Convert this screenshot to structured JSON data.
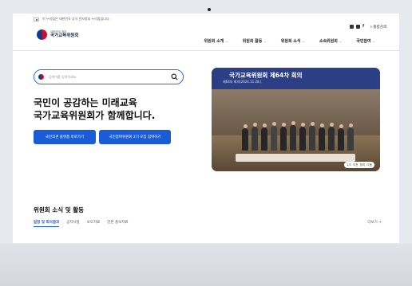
{
  "notice": "이 누리집은 대한민국 공식 전자정부 누리집입니다.",
  "logo": {
    "sub": "대한민국 정부",
    "name": "국가교육위원회"
  },
  "util": {
    "links": [
      "블로그",
      "유튜브",
      "페이스북"
    ],
    "search_label": "통합검색"
  },
  "nav": [
    {
      "label": "위원회 소개"
    },
    {
      "label": "위원회 활동"
    },
    {
      "label": "위원회 소식"
    },
    {
      "label": "소속위원회"
    },
    {
      "label": "국민참여"
    }
  ],
  "search": {
    "placeholder": "검색어를 입력하세요"
  },
  "headline": {
    "line1": "국민이 공감하는 미래교육",
    "line2": "국가교육위원회가 함께합니다."
  },
  "buttons": {
    "primary": "국민의견 플랫폼 바로가기",
    "secondary": "국민참여위원회 2기 모집 참여하기"
  },
  "hero": {
    "banner_title": "국가교육위원회 제64차 회의",
    "banner_sub": "제64차 회의(2024.11.28.)",
    "controls": [
      "1/3",
      "이전",
      "정지",
      "다음"
    ]
  },
  "section": {
    "title": "위원회 소식 및 활동",
    "tabs": [
      "일정 및 회의결과",
      "공지사항",
      "보도자료",
      "언론 홍보자료"
    ],
    "active_tab": 0,
    "more": "더보기 +"
  },
  "colors": {
    "accent": "#1a5bd6",
    "banner": "#2c3f85",
    "border_search": "#2f6fd4"
  }
}
